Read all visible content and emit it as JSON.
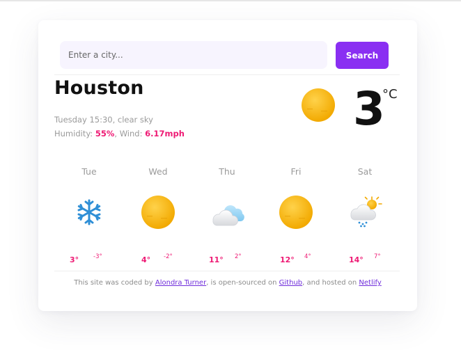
{
  "search": {
    "placeholder": "Enter a city...",
    "button_label": "Search"
  },
  "current": {
    "city": "Houston",
    "datetime": "Tuesday 15:30",
    "description": "clear sky",
    "humidity_label": "Humidity: ",
    "humidity_value": "55%",
    "wind_label": "Wind: ",
    "wind_value": "6.17mph",
    "temperature": "3",
    "unit": "°C",
    "icon": "sun-icon"
  },
  "forecast": [
    {
      "day": "Tue",
      "high": "3°",
      "low": "-3°",
      "icon": "snowflake-icon"
    },
    {
      "day": "Wed",
      "high": "4°",
      "low": "-2°",
      "icon": "sun-icon"
    },
    {
      "day": "Thu",
      "high": "11°",
      "low": "2°",
      "icon": "cloud-sun-icon"
    },
    {
      "day": "Fri",
      "high": "12°",
      "low": "4°",
      "icon": "sun-icon"
    },
    {
      "day": "Sat",
      "high": "14°",
      "low": "7°",
      "icon": "rain-cloud-sun-icon"
    }
  ],
  "footer": {
    "text1": "This site was coded by ",
    "author": "Alondra Turner",
    "text2": ", is open-sourced on ",
    "github": "Github",
    "text3": ", and hosted on ",
    "netlify": "Netlify"
  },
  "colors": {
    "accent": "#8a2ff2",
    "highlight": "#ee1a74",
    "sun": "#f4b400"
  }
}
